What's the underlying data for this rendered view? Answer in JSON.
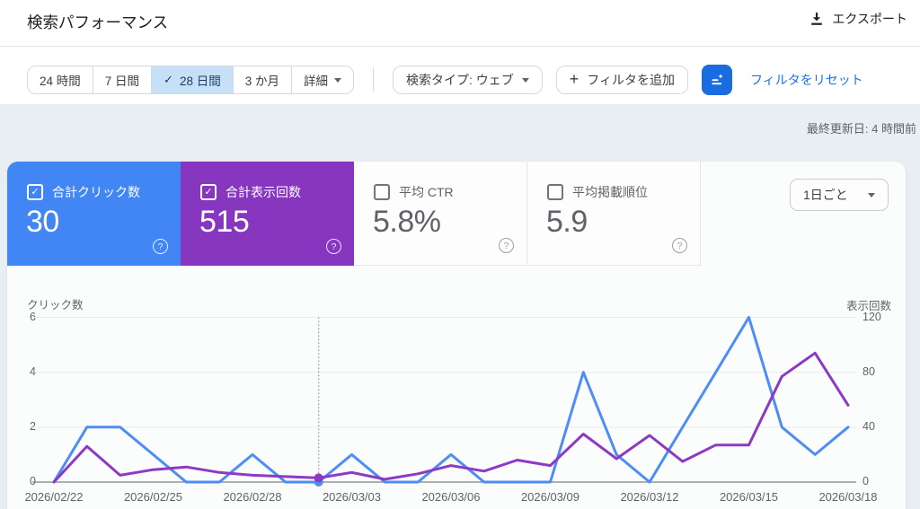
{
  "header": {
    "title": "検索パフォーマンス",
    "export_label": "エクスポート"
  },
  "filters": {
    "date_tabs": [
      {
        "label": "24 時間",
        "selected": false
      },
      {
        "label": "7 日間",
        "selected": false
      },
      {
        "label": "28 日間",
        "selected": true
      },
      {
        "label": "3 か月",
        "selected": false
      },
      {
        "label": "詳細",
        "selected": false
      }
    ],
    "search_type_label": "検索タイプ: ウェブ",
    "add_filter_label": "フィルタを追加",
    "reset_filters_label": "フィルタをリセット"
  },
  "status": {
    "last_updated": "最終更新日: 4 時間前"
  },
  "metrics": {
    "granularity_label": "1日ごと",
    "cards": [
      {
        "label": "合計クリック数",
        "value": "30",
        "checked": true,
        "color": "#4285f4"
      },
      {
        "label": "合計表示回数",
        "value": "515",
        "checked": true,
        "color": "#8636bf"
      },
      {
        "label": "平均 CTR",
        "value": "5.8%",
        "checked": false
      },
      {
        "label": "平均掲載順位",
        "value": "5.9",
        "checked": false
      }
    ]
  },
  "chart_data": {
    "type": "line",
    "granularity": "1日ごと",
    "dates": [
      "2026/02/22",
      "2026/02/23",
      "2026/02/24",
      "2026/02/25",
      "2026/02/26",
      "2026/02/27",
      "2026/02/28",
      "2026/03/01",
      "2026/03/02",
      "2026/03/03",
      "2026/03/04",
      "2026/03/05",
      "2026/03/06",
      "2026/03/07",
      "2026/03/08",
      "2026/03/09",
      "2026/03/10",
      "2026/03/11",
      "2026/03/12",
      "2026/03/13",
      "2026/03/14",
      "2026/03/15",
      "2026/03/16",
      "2026/03/17",
      "2026/03/18"
    ],
    "x_ticks": [
      {
        "index": 0,
        "label": "2026/02/22"
      },
      {
        "index": 3,
        "label": "2026/02/25"
      },
      {
        "index": 6,
        "label": "2026/02/28"
      },
      {
        "index": 9,
        "label": "2026/03/03"
      },
      {
        "index": 12,
        "label": "2026/03/06"
      },
      {
        "index": 15,
        "label": "2026/03/09"
      },
      {
        "index": 18,
        "label": "2026/03/12"
      },
      {
        "index": 21,
        "label": "2026/03/15"
      },
      {
        "index": 24,
        "label": "2026/03/18"
      }
    ],
    "series": [
      {
        "name": "合計クリック数",
        "axis": "left",
        "color": "#4d8df6",
        "total": 30,
        "values": [
          0,
          2,
          2,
          1,
          0,
          0,
          1,
          0,
          0,
          1,
          0,
          0,
          1,
          0,
          0,
          0,
          4,
          1,
          0,
          2,
          4,
          6,
          2,
          1,
          2
        ]
      },
      {
        "name": "合計表示回数",
        "axis": "right",
        "color": "#8d39c4",
        "total": 515,
        "values": [
          0,
          26,
          5,
          9,
          11,
          7,
          5,
          4,
          3,
          7,
          2,
          6,
          12,
          8,
          16,
          12,
          35,
          17,
          34,
          15,
          27,
          27,
          77,
          94,
          56
        ]
      }
    ],
    "left_axis": {
      "label": "クリック数",
      "ticks": [
        0,
        2,
        4,
        6
      ],
      "range": [
        0,
        6
      ]
    },
    "right_axis": {
      "label": "表示回数",
      "ticks": [
        0,
        40,
        80,
        120
      ],
      "range": [
        0,
        120
      ]
    },
    "hover_marker": {
      "date": "2026/03/02",
      "index": 8,
      "clicks": 0,
      "impressions": 3
    },
    "grid": true,
    "legend_position": "none"
  }
}
